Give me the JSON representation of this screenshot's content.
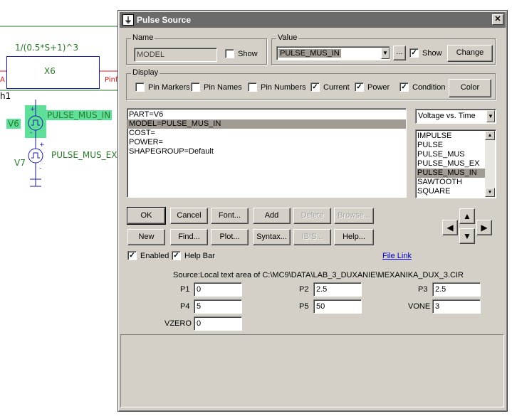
{
  "schematic": {
    "transfer_fn": "1/(0.5*S+1)^3",
    "block_name": "X6",
    "pin_left": "A",
    "pin_right": "Pinf",
    "partial_label": "h1",
    "v6_name": "V6",
    "v6_model": "PULSE_MUS_IN",
    "v7_name": "V7",
    "v7_model": "PULSE_MUS_EX",
    "plus": "+",
    "minus": "-"
  },
  "dialog": {
    "title": "Pulse Source",
    "close": "✕",
    "name_group": {
      "legend": "Name",
      "value": "MODEL",
      "show_label": "Show",
      "show_checked": false
    },
    "value_group": {
      "legend": "Value",
      "value": "PULSE_MUS_IN",
      "ellipsis": "...",
      "show_label": "Show",
      "show_checked": true,
      "change_label": "Change"
    },
    "display_group": {
      "legend": "Display",
      "items": [
        {
          "label": "Pin Markers",
          "checked": false
        },
        {
          "label": "Pin Names",
          "checked": false
        },
        {
          "label": "Pin Numbers",
          "checked": false
        },
        {
          "label": "Current",
          "checked": true
        },
        {
          "label": "Power",
          "checked": true
        },
        {
          "label": "Condition",
          "checked": true
        }
      ],
      "color_label": "Color"
    },
    "attributes": [
      "PART=V6",
      "MODEL=PULSE_MUS_IN",
      "COST=",
      "POWER=",
      "SHAPEGROUP=Default"
    ],
    "attributes_selected_index": 1,
    "plot_mode": "Voltage vs. Time",
    "models": [
      "IMPULSE",
      "PULSE",
      "PULSE_MUS",
      "PULSE_MUS_EX",
      "PULSE_MUS_IN",
      "SAWTOOTH",
      "SQUARE"
    ],
    "models_selected_index": 4,
    "buttons_row1": [
      {
        "label": "OK",
        "enabled": true
      },
      {
        "label": "Cancel",
        "enabled": true
      },
      {
        "label": "Font...",
        "enabled": true
      },
      {
        "label": "Add",
        "enabled": true
      },
      {
        "label": "Delete",
        "enabled": false
      },
      {
        "label": "Browse...",
        "enabled": false
      }
    ],
    "buttons_row2": [
      {
        "label": "New",
        "enabled": true
      },
      {
        "label": "Find...",
        "enabled": true
      },
      {
        "label": "Plot...",
        "enabled": true
      },
      {
        "label": "Syntax...",
        "enabled": true
      },
      {
        "label": "IBIS...",
        "enabled": false
      },
      {
        "label": "Help...",
        "enabled": true
      }
    ],
    "enabled_label": "Enabled",
    "enabled_checked": true,
    "helpbar_label": "Help Bar",
    "helpbar_checked": true,
    "file_link": "File Link",
    "source_text": "Source:Local text area of C:\\MC9\\DATA\\LAB_3_DUXANIE\\MEXANIKA_DUX_3.CIR",
    "params": [
      {
        "name": "P1",
        "value": "0"
      },
      {
        "name": "P2",
        "value": "2.5"
      },
      {
        "name": "P3",
        "value": "2.5"
      },
      {
        "name": "P4",
        "value": "5"
      },
      {
        "name": "P5",
        "value": "50"
      },
      {
        "name": "VONE",
        "value": "3"
      },
      {
        "name": "VZERO",
        "value": "0"
      }
    ],
    "arrows": {
      "up": "▲",
      "down": "▼",
      "left": "◀",
      "right": "▶",
      "dropdown": "▼"
    },
    "colors": {
      "title_bar": "#6b6b6b",
      "face": "#d4d0c8",
      "selection": "#a09b93",
      "link": "#0000cc",
      "schematic_green": "#2a7a2a",
      "source_highlight": "#5fe09a"
    }
  }
}
